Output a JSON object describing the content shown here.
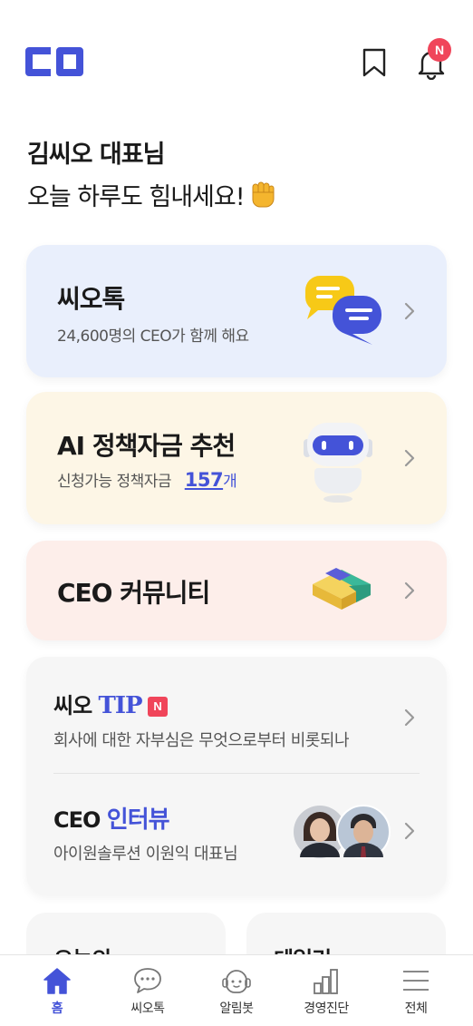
{
  "header": {
    "logo_text": "CO",
    "notification_badge": "N"
  },
  "greeting": {
    "name": "김씨오 대표님",
    "message": "오늘 하루도 힘내세요!"
  },
  "cards": {
    "ceotalk": {
      "title": "씨오톡",
      "subtitle": "24,600명의 CEO가 함께 해요"
    },
    "ai_fund": {
      "title": "AI 정책자금 추천",
      "subtitle": "신청가능 정책자금",
      "count": "157",
      "count_unit": "개"
    },
    "community": {
      "title": "CEO 커뮤니티"
    },
    "tip": {
      "title_prefix": "씨오",
      "title_accent": "TIP",
      "badge": "N",
      "subtitle": "회사에 대한 자부심은 무엇으로부터 비롯되나"
    },
    "interview": {
      "title_prefix": "CEO",
      "title_accent": "인터뷰",
      "subtitle": "아이원솔루션 이원익 대표님"
    }
  },
  "mini_cards": {
    "left_title": "오늘의",
    "right_title": "데일리"
  },
  "tabbar": {
    "items": [
      {
        "label": "홈",
        "icon": "home-icon"
      },
      {
        "label": "씨오톡",
        "icon": "chat-icon"
      },
      {
        "label": "알림봇",
        "icon": "bot-icon"
      },
      {
        "label": "경영진단",
        "icon": "chart-icon"
      },
      {
        "label": "전체",
        "icon": "menu-icon"
      }
    ]
  },
  "colors": {
    "accent": "#4453d8",
    "badge": "#f0455a",
    "ceotalk_bg": "#e9effc",
    "ai_bg": "#fdf6e6",
    "community_bg": "#fdeeea",
    "tips_bg": "#f6f6f6"
  }
}
